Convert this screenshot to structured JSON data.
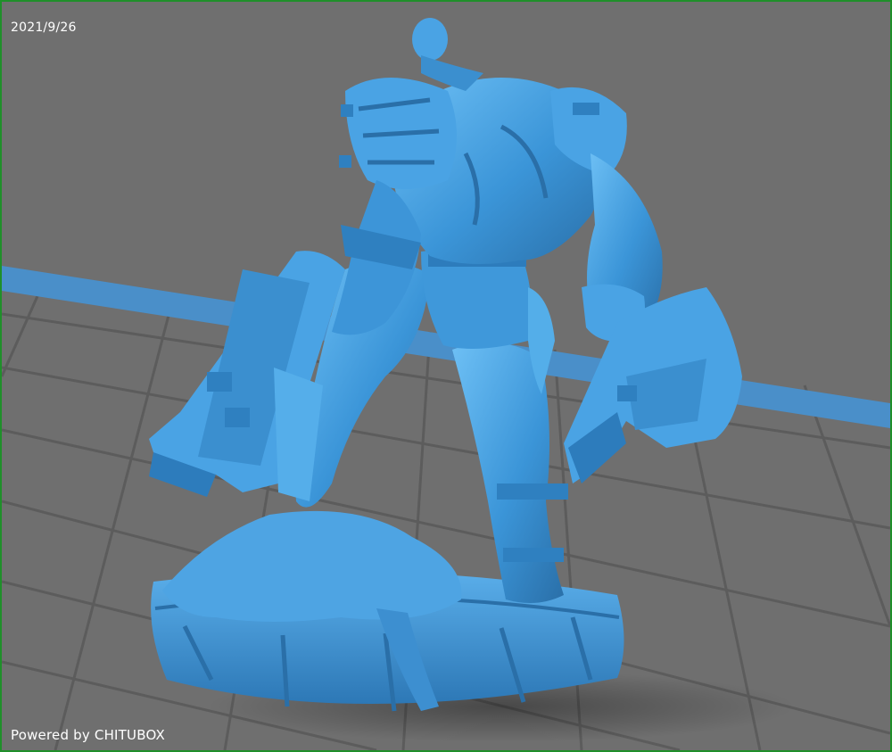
{
  "viewport": {
    "date_stamp": "2021/9/26",
    "powered_by": "Powered by CHITUBOX"
  },
  "colors": {
    "background": "#6f6f6f",
    "grid_line": "#5a5a5a",
    "platform_edge": "#4a8fc9",
    "model": "#3d97db",
    "model_shadow": "#2a6fa8",
    "model_highlight": "#72bff2",
    "frame_border": "#1f8f2a"
  },
  "scene": {
    "model_name_icon": "figurine-model-icon",
    "grid_icon": "build-plate-grid-icon"
  }
}
